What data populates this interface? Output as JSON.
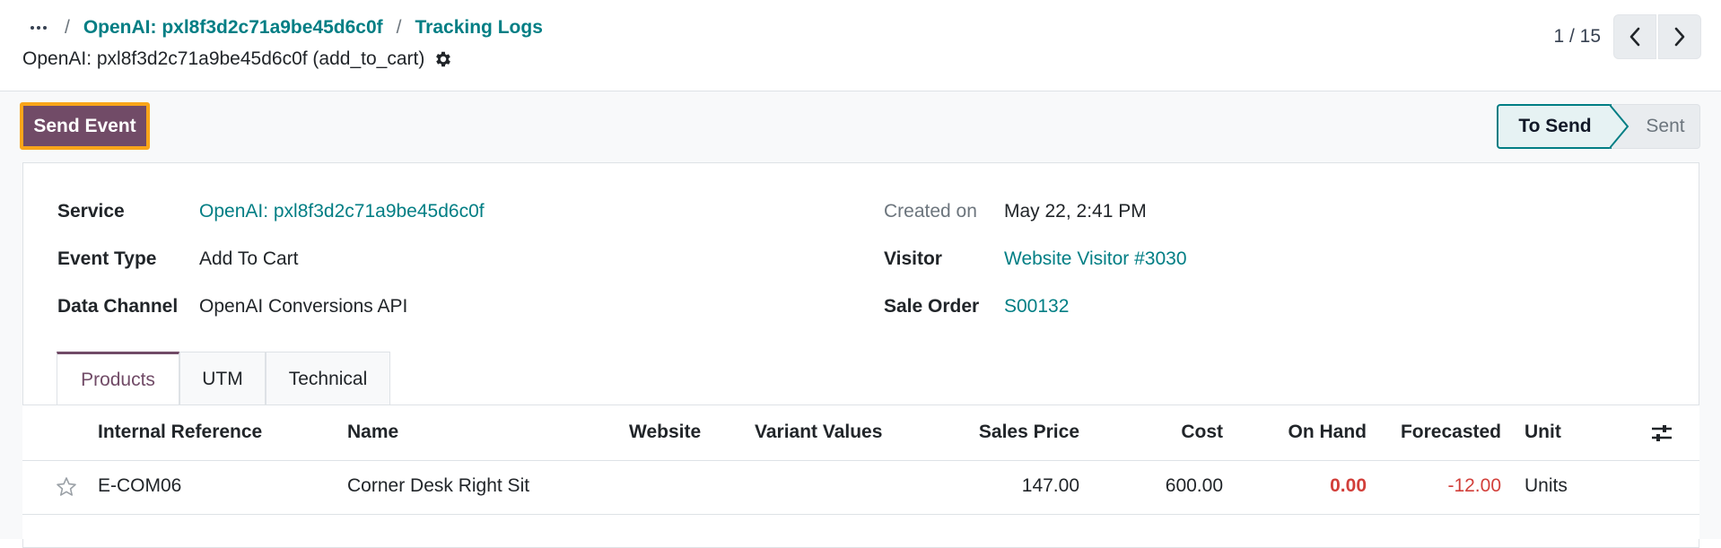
{
  "breadcrumb": {
    "items": [
      "OpenAI: pxl8f3d2c71a9be45d6c0f",
      "Tracking Logs"
    ],
    "separator": "/"
  },
  "record": {
    "title": "OpenAI: pxl8f3d2c71a9be45d6c0f (add_to_cart)"
  },
  "pager": {
    "value": "1 / 15"
  },
  "actions": {
    "send_event": "Send Event"
  },
  "status": {
    "steps": [
      "To Send",
      "Sent"
    ],
    "current": "To Send"
  },
  "fields": {
    "service": {
      "label": "Service",
      "value": "OpenAI: pxl8f3d2c71a9be45d6c0f"
    },
    "event_type": {
      "label": "Event Type",
      "value": "Add To Cart"
    },
    "data_channel": {
      "label": "Data Channel",
      "value": "OpenAI Conversions API"
    },
    "created_on": {
      "label": "Created on",
      "value": "May 22, 2:41 PM"
    },
    "visitor": {
      "label": "Visitor",
      "value": "Website Visitor #3030"
    },
    "sale_order": {
      "label": "Sale Order",
      "value": "S00132"
    }
  },
  "tabs": [
    "Products",
    "UTM",
    "Technical"
  ],
  "active_tab": "Products",
  "table": {
    "columns": [
      "Internal Reference",
      "Name",
      "Website",
      "Variant Values",
      "Sales Price",
      "Cost",
      "On Hand",
      "Forecasted",
      "Unit"
    ],
    "rows": [
      [
        "E-COM06",
        "Corner Desk Right Sit",
        "",
        "",
        "147.00",
        "600.00",
        "0.00",
        "-12.00",
        "Units"
      ]
    ]
  },
  "colors": {
    "primary": "#714b67",
    "link": "#017e84",
    "focus_outline": "#f9a51a",
    "danger": "#d23f3a"
  },
  "icons": [
    "ellipsis-icon",
    "gear-icon",
    "chevron-left-icon",
    "chevron-right-icon",
    "star-icon",
    "optional-columns-icon"
  ]
}
